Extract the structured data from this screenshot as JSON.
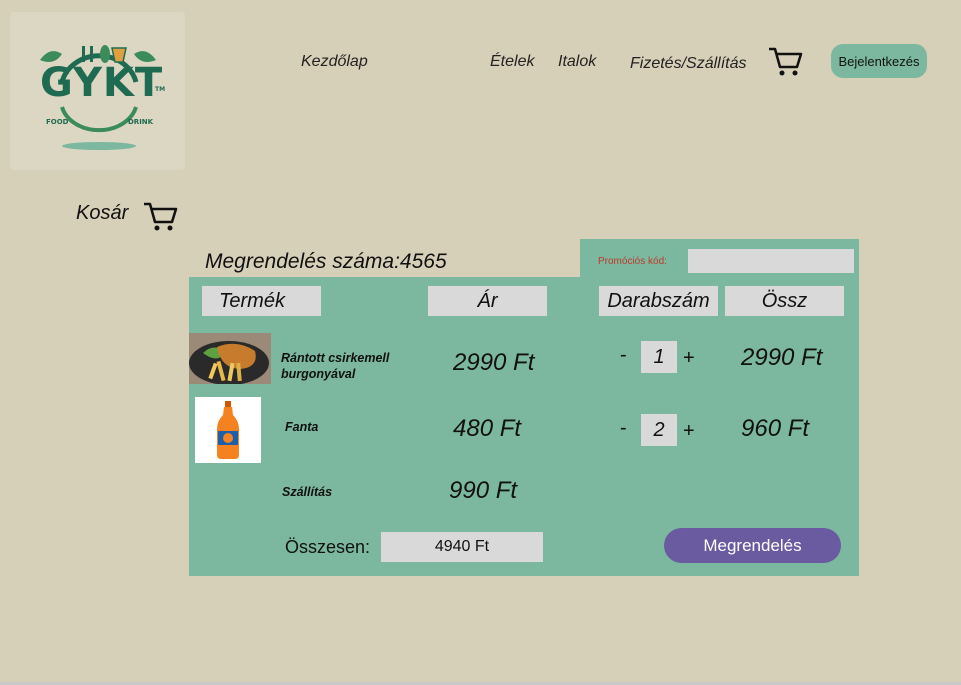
{
  "logo": {
    "text": "GYKT",
    "tm": "TM",
    "sub_left": "FOOD",
    "sub_right": "DRINK"
  },
  "nav": {
    "home": "Kezdőlap",
    "foods": "Ételek",
    "drinks": "Italok",
    "payment": "Fizetés/Szállítás",
    "login": "Bejelentkezés"
  },
  "cart": {
    "title": "Kosár"
  },
  "order": {
    "number_label": "Megrendelés száma:4565"
  },
  "promo": {
    "label": "Promóciós kód:",
    "value": ""
  },
  "table": {
    "headers": [
      "Termék",
      "Ár",
      "Darabszám",
      "Össz"
    ],
    "rows": [
      {
        "name_line1": "Rántott csirkemell",
        "name_line2": "burgonyával",
        "price": "2990 Ft",
        "qty": "1",
        "total": "2990 Ft",
        "image": "schnitzel-fries"
      },
      {
        "name_line1": "Fanta",
        "name_line2": "",
        "price": "480 Ft",
        "qty": "2",
        "total": "960 Ft",
        "image": "fanta-bottle"
      }
    ],
    "shipping": {
      "label": "Szállítás",
      "price": "990 Ft"
    },
    "minus": "-",
    "plus": "+"
  },
  "summary": {
    "label": "Összesen:",
    "value": "4940 Ft",
    "order_button": "Megrendelés"
  },
  "colors": {
    "background": "#d6d0b8",
    "panel": "#7bb89f",
    "field": "#d9d9d9",
    "order_button": "#6a5aa0",
    "brand": "#1f6b52"
  }
}
